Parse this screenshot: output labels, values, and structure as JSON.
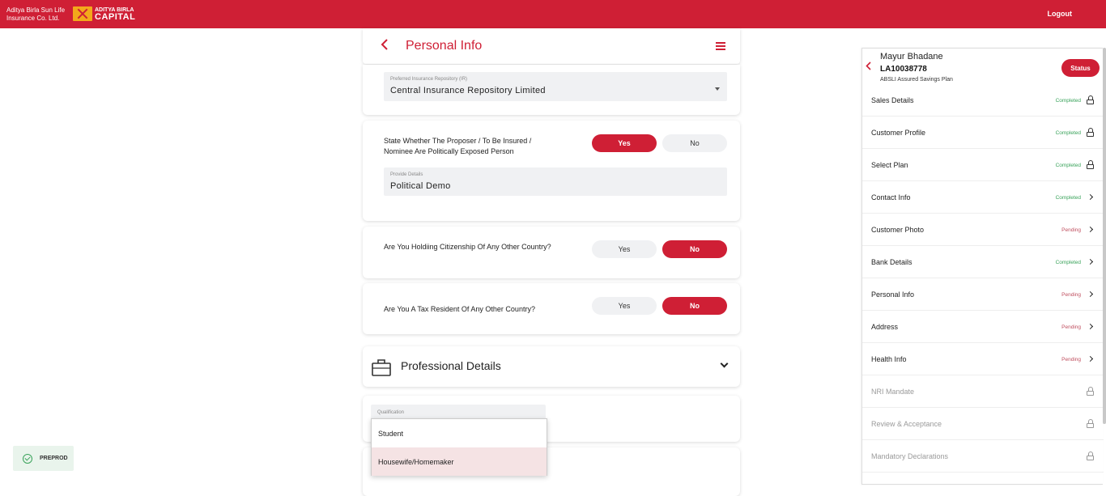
{
  "topbar": {
    "brand_line1": "Aditya Birla Sun Life",
    "brand_line2": "Insurance Co. Ltd.",
    "capital_line1": "ADITYA BIRLA",
    "capital_line2": "CAPITAL",
    "logout_label": "Logout",
    "color": "#cf1f35"
  },
  "header": {
    "back_icon": "chevron-left-icon",
    "title": "Personal Info",
    "menu_icon": "hamburger-menu-icon"
  },
  "ir": {
    "label": "Preferred Insurance Repository (IR)",
    "value": "Central Insurance Repository Limited"
  },
  "pep": {
    "question": "State Whether The Proposer / To Be Insured / Nominee Are Politically Exposed Person",
    "yes": "Yes",
    "no": "No",
    "selected": "Yes",
    "details_label": "Provide Details",
    "details_value": "Political Demo"
  },
  "citizenship": {
    "question": "Are You Holdiing Citizenship Of Any Other Country?",
    "yes": "Yes",
    "no": "No",
    "selected": "No"
  },
  "tax": {
    "question": "Are You A Tax Resident Of Any Other Country?",
    "yes": "Yes",
    "no": "No",
    "selected": "No"
  },
  "professional": {
    "title": "Professional Details",
    "icon": "briefcase-icon",
    "qualification_label": "Qualification",
    "options": [
      "Student",
      "Housewife/Homemaker"
    ],
    "highlighted": "Housewife/Homemaker"
  },
  "preprod": {
    "label": "PREPROD",
    "icon": "check-circle-icon"
  },
  "panel": {
    "name": "Mayur Bhadane",
    "id": "LA10038778",
    "plan": "ABSLI Assured Savings Plan",
    "status_label": "Status",
    "items": [
      {
        "label": "Sales Details",
        "status": "Completed",
        "icon": "lock-icon"
      },
      {
        "label": "Customer Profile",
        "status": "Completed",
        "icon": "lock-icon"
      },
      {
        "label": "Select Plan",
        "status": "Completed",
        "icon": "lock-icon"
      },
      {
        "label": "Contact Info",
        "status": "Completed",
        "icon": "chevron-right-icon"
      },
      {
        "label": "Customer Photo",
        "status": "Pending",
        "icon": "chevron-right-icon"
      },
      {
        "label": "Bank Details",
        "status": "Completed",
        "icon": "chevron-right-icon"
      },
      {
        "label": "Personal Info",
        "status": "Pending",
        "icon": "chevron-right-icon"
      },
      {
        "label": "Address",
        "status": "Pending",
        "icon": "chevron-right-icon"
      },
      {
        "label": "Health Info",
        "status": "Pending",
        "icon": "chevron-right-icon"
      },
      {
        "label": "NRI Mandate",
        "status": "",
        "icon": "lock-icon"
      },
      {
        "label": "Review & Acceptance",
        "status": "",
        "icon": "lock-icon"
      },
      {
        "label": "Mandatory Declarations",
        "status": "",
        "icon": "lock-icon"
      }
    ]
  }
}
